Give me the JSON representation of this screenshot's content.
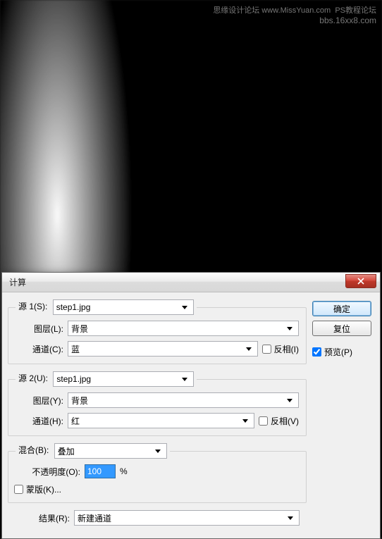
{
  "watermark": {
    "line1": "思缘设计论坛  www.MissYuan.com",
    "line2": "bbs.16xx8.com",
    "label": "PS教程论坛"
  },
  "dialog": {
    "title": "计算",
    "source1": {
      "legend": "源 1(S):",
      "file": "step1.jpg",
      "layer_label": "图层(L):",
      "layer": "背景",
      "channel_label": "通道(C):",
      "channel": "蓝",
      "invert_label": "反相(I)"
    },
    "source2": {
      "legend": "源 2(U):",
      "file": "step1.jpg",
      "layer_label": "图层(Y):",
      "layer": "背景",
      "channel_label": "通道(H):",
      "channel": "红",
      "invert_label": "反相(V)"
    },
    "blending": {
      "legend": "混合(B):",
      "mode": "叠加",
      "opacity_label": "不透明度(O):",
      "opacity": "100",
      "percent": "%",
      "mask_label": "蒙版(K)..."
    },
    "result": {
      "label": "结果(R):",
      "value": "新建通道"
    },
    "buttons": {
      "ok": "确定",
      "reset": "复位",
      "preview": "预览(P)"
    }
  }
}
